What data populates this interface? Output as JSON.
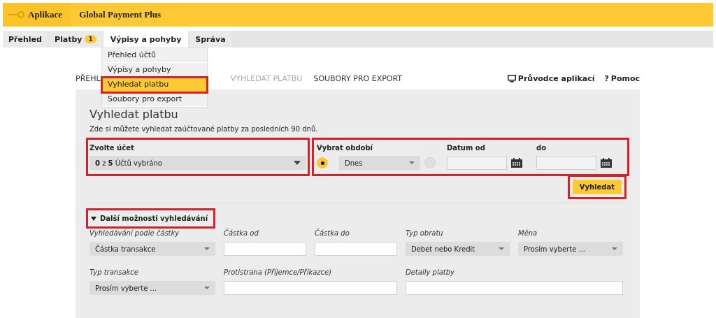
{
  "header": {
    "app_label": "Aplikace",
    "title": "Global Payment Plus"
  },
  "nav": [
    {
      "label": "Přehled",
      "selected": false
    },
    {
      "label": "Platby",
      "badge": "1",
      "selected": false
    },
    {
      "label": "Výpisy a pohyby",
      "selected": true
    },
    {
      "label": "Správa",
      "selected": false
    }
  ],
  "nav_menu": [
    {
      "label": "Přehled účtů",
      "selected": false,
      "highlighted": false
    },
    {
      "label": "Výpisy a pohyby",
      "selected": false,
      "highlighted": false
    },
    {
      "label": "Vyhledat platbu",
      "selected": true,
      "highlighted": true
    },
    {
      "label": "Soubory pro export",
      "selected": false,
      "highlighted": false
    }
  ],
  "subtabs": [
    {
      "label": "PŘEHL",
      "selected": false
    },
    {
      "label": "VYHLEDAT PLATBU",
      "selected": true
    },
    {
      "label": "SOUBORY PRO EXPORT",
      "selected": false
    }
  ],
  "links": [
    {
      "kind": "guide",
      "label": "Průvodce aplikací"
    },
    {
      "kind": "help",
      "icon": "?",
      "label": "Pomoc"
    }
  ],
  "page": {
    "title": "Vyhledat platbu",
    "description": "Zde si můžete vyhledat zaúčtované platby za posledních 90 dnů."
  },
  "account": {
    "label": "Zvolte účet",
    "value": "**0** z **5** Účtů vybráno",
    "highlighted": true
  },
  "period_filter": {
    "highlighted": true,
    "preset": {
      "label": "Vybrat období",
      "value": "Dnes",
      "selected": true
    },
    "range": {
      "from_label": "Datum od",
      "to_label": "do",
      "selected": false
    }
  },
  "search_button": {
    "label": "Vyhledat",
    "highlighted": true
  },
  "more_options": {
    "label": "Další možnosti vyhledávání",
    "expanded": true,
    "highlighted": true
  },
  "field_rows": [
    [
      {
        "kind": "select",
        "label": "Vyhledávání podle částky",
        "value": "Částka transakce"
      },
      {
        "kind": "input",
        "label": "Částka od"
      },
      {
        "kind": "input",
        "label": "Částka do"
      },
      {
        "kind": "select",
        "label": "Typ obratu",
        "value": "Debet nebo Kredit"
      },
      {
        "kind": "select",
        "label": "Měna",
        "value": "Prosím vyberte ..."
      }
    ],
    [
      {
        "kind": "select",
        "label": "Typ transakce",
        "value": "Prosím vyberte ..."
      },
      {
        "kind": "wide_input",
        "label": "Protistrana (Příjemce/Příkazce)"
      },
      {
        "kind": "wide_input",
        "label": "Detaily platby"
      }
    ]
  ]
}
